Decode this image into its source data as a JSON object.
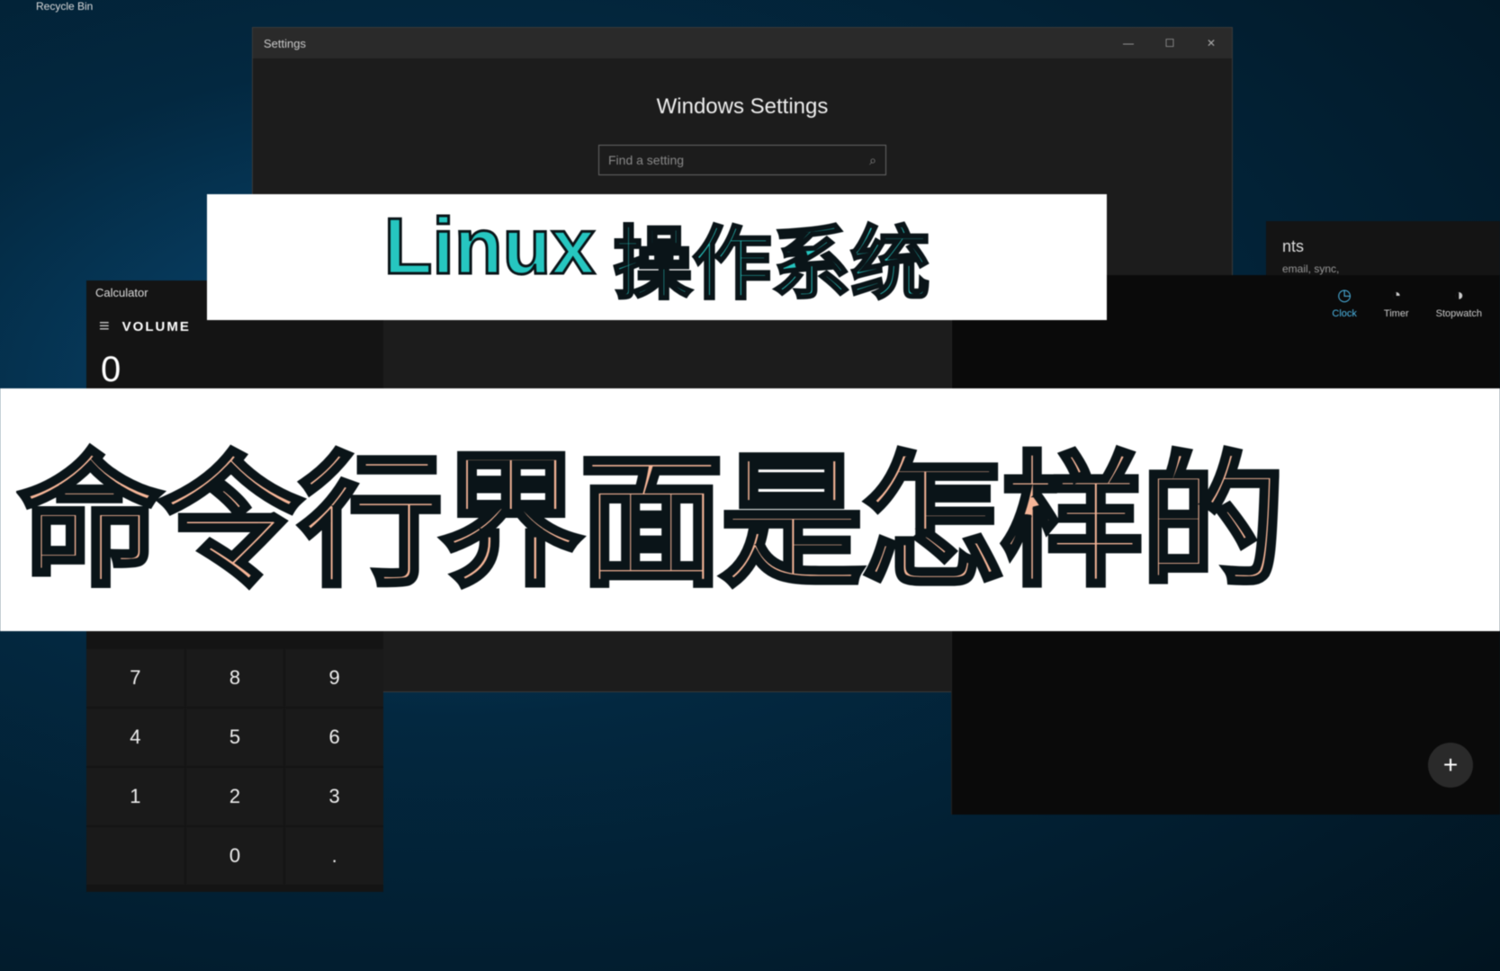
{
  "desktop": {
    "recycle_label": "Recycle Bin"
  },
  "settings": {
    "titlebar_label": "Settings",
    "heading": "Windows Settings",
    "search_placeholder": "Find a setting",
    "win_min": "—",
    "win_max": "☐",
    "win_close": "✕"
  },
  "accounts": {
    "title": "nts",
    "subtitle": "email, sync,"
  },
  "clock": {
    "tabs": [
      {
        "icon": "◷",
        "label": "Clock",
        "active": true
      },
      {
        "icon": "◔",
        "label": "Timer",
        "active": false
      },
      {
        "icon": "◑",
        "label": "Stopwatch",
        "active": false
      }
    ],
    "add_label": "+"
  },
  "calculator": {
    "titlebar_label": "Calculator",
    "mode_label": "VOLUME",
    "display_value": "0",
    "keys": [
      "7",
      "8",
      "9",
      "4",
      "5",
      "6",
      "1",
      "2",
      "3",
      "",
      "0",
      "."
    ]
  },
  "overlay": {
    "line1_part1": "Linux",
    "line1_part2": "操作系统",
    "line2": "命令行界面是怎样的"
  }
}
